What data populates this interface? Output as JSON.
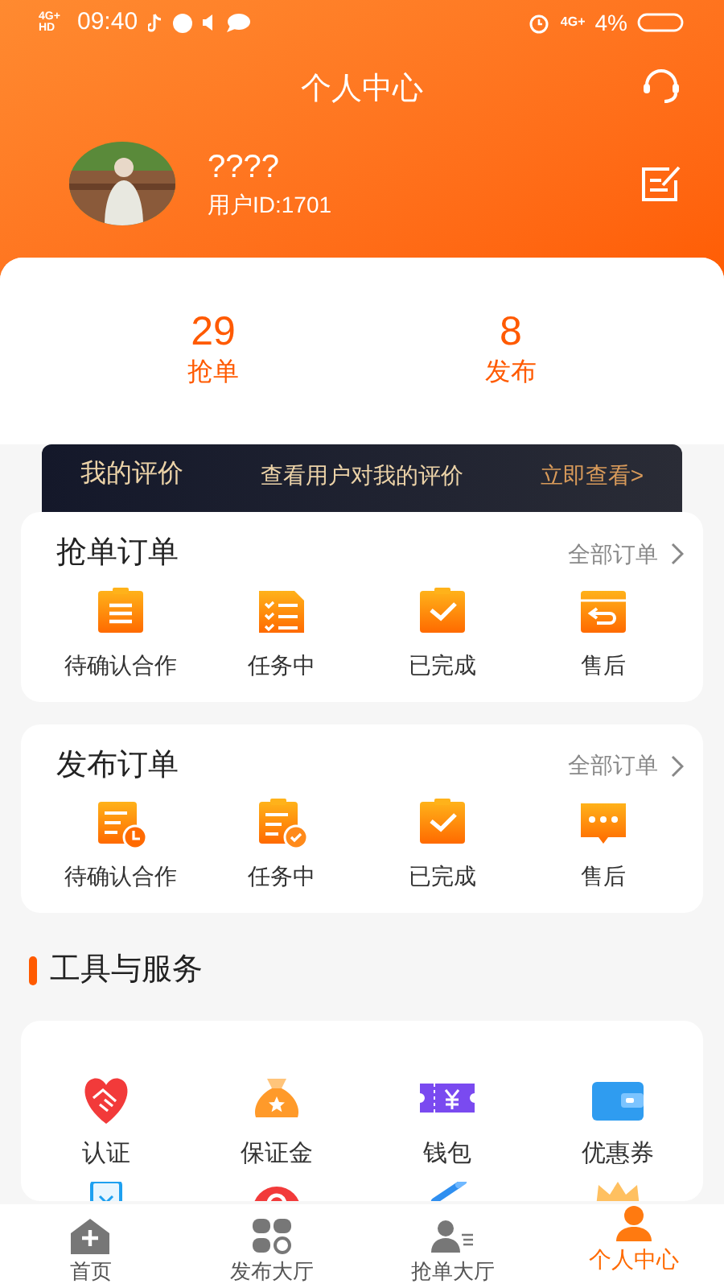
{
  "status_bar": {
    "network": "4G+HD",
    "time": "09:40",
    "network_2": "4G+",
    "battery": "4%"
  },
  "header": {
    "title": "个人中心"
  },
  "profile": {
    "name": "????",
    "user_id": "用户ID:1701"
  },
  "stats": [
    {
      "value": "29",
      "label": "抢单"
    },
    {
      "value": "8",
      "label": "发布"
    }
  ],
  "review_banner": {
    "title": "我的评价",
    "subtitle": "查看用户对我的评价",
    "link": "立即查看>"
  },
  "order_sections": [
    {
      "title": "抢单订单",
      "all_link": "全部订单",
      "items": [
        {
          "kind": "list",
          "label": "待确认合作"
        },
        {
          "kind": "checklist",
          "label": "任务中"
        },
        {
          "kind": "done",
          "label": "已完成"
        },
        {
          "kind": "return",
          "label": "售后"
        }
      ]
    },
    {
      "title": "发布订单",
      "all_link": "全部订单",
      "items": [
        {
          "kind": "clock",
          "label": "待确认合作"
        },
        {
          "kind": "pending",
          "label": "任务中"
        },
        {
          "kind": "done",
          "label": "已完成"
        },
        {
          "kind": "chat",
          "label": "售后"
        }
      ]
    }
  ],
  "tools": {
    "title": "工具与服务",
    "items": [
      {
        "kind": "heart",
        "label": "认证"
      },
      {
        "kind": "bag",
        "label": "保证金"
      },
      {
        "kind": "ticket",
        "label": "钱包"
      },
      {
        "kind": "wallet",
        "label": "优惠券"
      },
      {
        "kind": "phone"
      },
      {
        "kind": "question"
      },
      {
        "kind": "pen"
      },
      {
        "kind": "crown"
      }
    ]
  },
  "tab_bar": [
    {
      "kind": "home",
      "label": "首页",
      "selected": false
    },
    {
      "kind": "grid",
      "label": "发布大厅",
      "selected": false
    },
    {
      "kind": "user-list",
      "label": "抢单大厅",
      "selected": false
    },
    {
      "kind": "person",
      "label": "个人中心",
      "selected": true
    }
  ]
}
